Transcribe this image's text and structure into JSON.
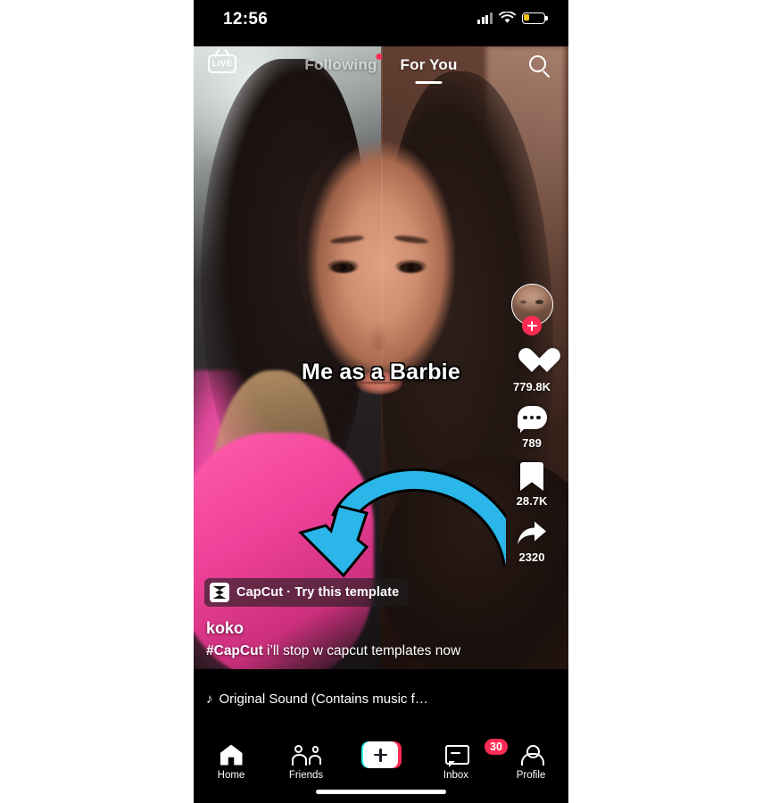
{
  "status_bar": {
    "time": "12:56",
    "icons": [
      "signal-bars",
      "wifi",
      "battery-low"
    ]
  },
  "top_nav": {
    "live_label": "LIVE",
    "tabs": [
      {
        "label": "Following",
        "active": false,
        "has_dot": true
      },
      {
        "label": "For You",
        "active": true,
        "has_dot": false
      }
    ],
    "search_icon": "search-icon"
  },
  "video_overlay": {
    "meme_text": "Me as a Barbie",
    "arrow_color": "#2ab6e8",
    "arrow_direction": "curved-down-left"
  },
  "action_rail": {
    "follow_button": "+",
    "items": [
      {
        "icon": "heart-icon",
        "count": "779.8K"
      },
      {
        "icon": "comment-icon",
        "count": "789"
      },
      {
        "icon": "bookmark-icon",
        "count": "28.7K"
      },
      {
        "icon": "share-icon",
        "count": "2320"
      }
    ]
  },
  "caption": {
    "capcut_label": "CapCut · Try this template",
    "author": "koko",
    "hashtag": "#CapCut",
    "description": "i’ll stop w capcut templates now",
    "sound": "Original Sound (Contains music f…"
  },
  "bottom_nav": {
    "items": [
      {
        "label": "Home",
        "icon": "home-icon",
        "active": true
      },
      {
        "label": "Friends",
        "icon": "friends-icon",
        "active": false
      },
      {
        "label": "",
        "icon": "create-icon",
        "active": false
      },
      {
        "label": "Inbox",
        "icon": "inbox-icon",
        "active": false,
        "badge": "30"
      },
      {
        "label": "Profile",
        "icon": "profile-icon",
        "active": false
      }
    ]
  },
  "colors": {
    "accent_pink": "#fe2c55",
    "accent_cyan": "#25f4ee",
    "arrow_blue": "#2ab6e8",
    "background": "#000000"
  }
}
